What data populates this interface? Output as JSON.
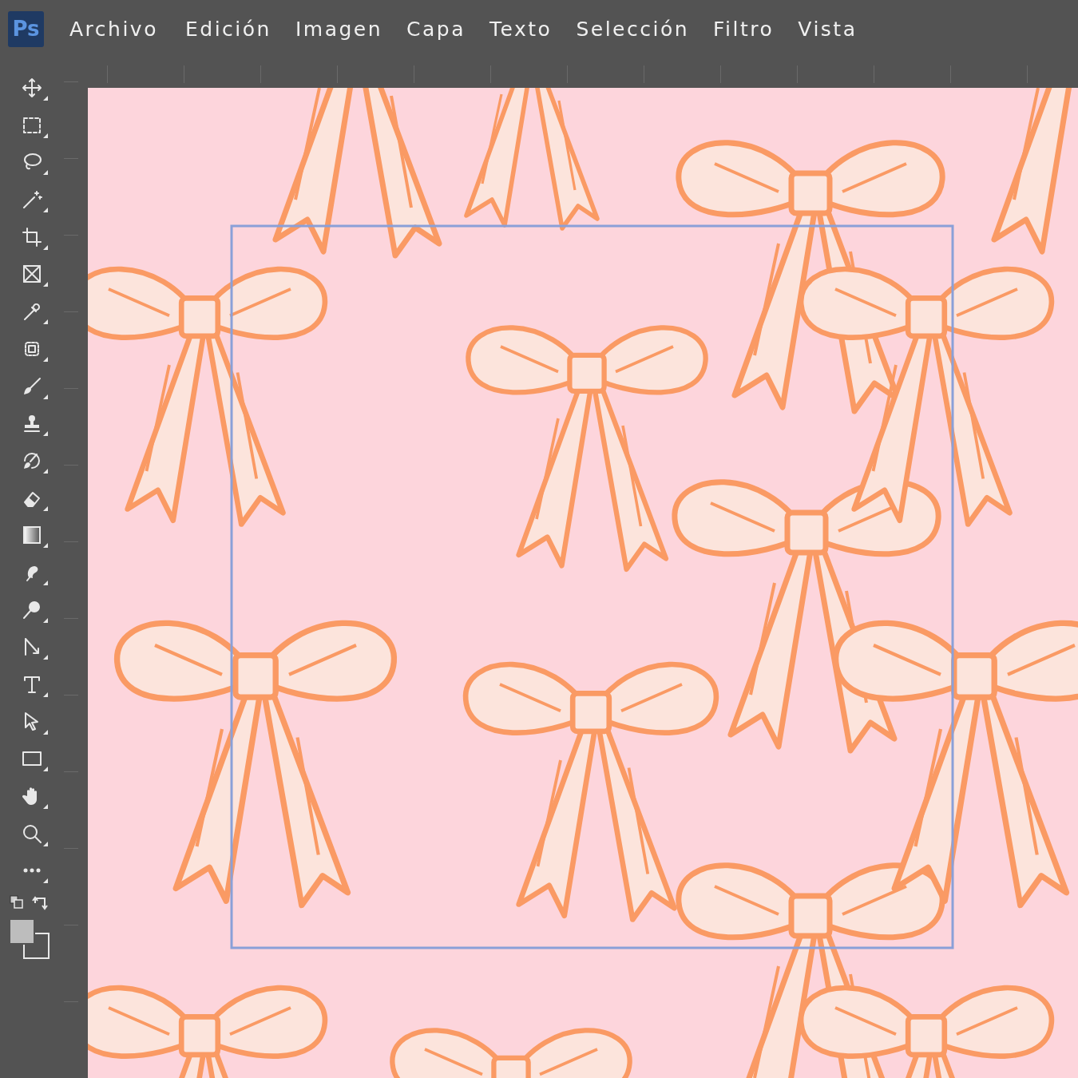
{
  "app_logo": "Ps",
  "menu": [
    {
      "label": "Archivo"
    },
    {
      "label": "Edición"
    },
    {
      "label": "Imagen"
    },
    {
      "label": "Capa"
    },
    {
      "label": "Texto"
    },
    {
      "label": "Selección"
    },
    {
      "label": "Filtro"
    },
    {
      "label": "Vista"
    }
  ]
}
